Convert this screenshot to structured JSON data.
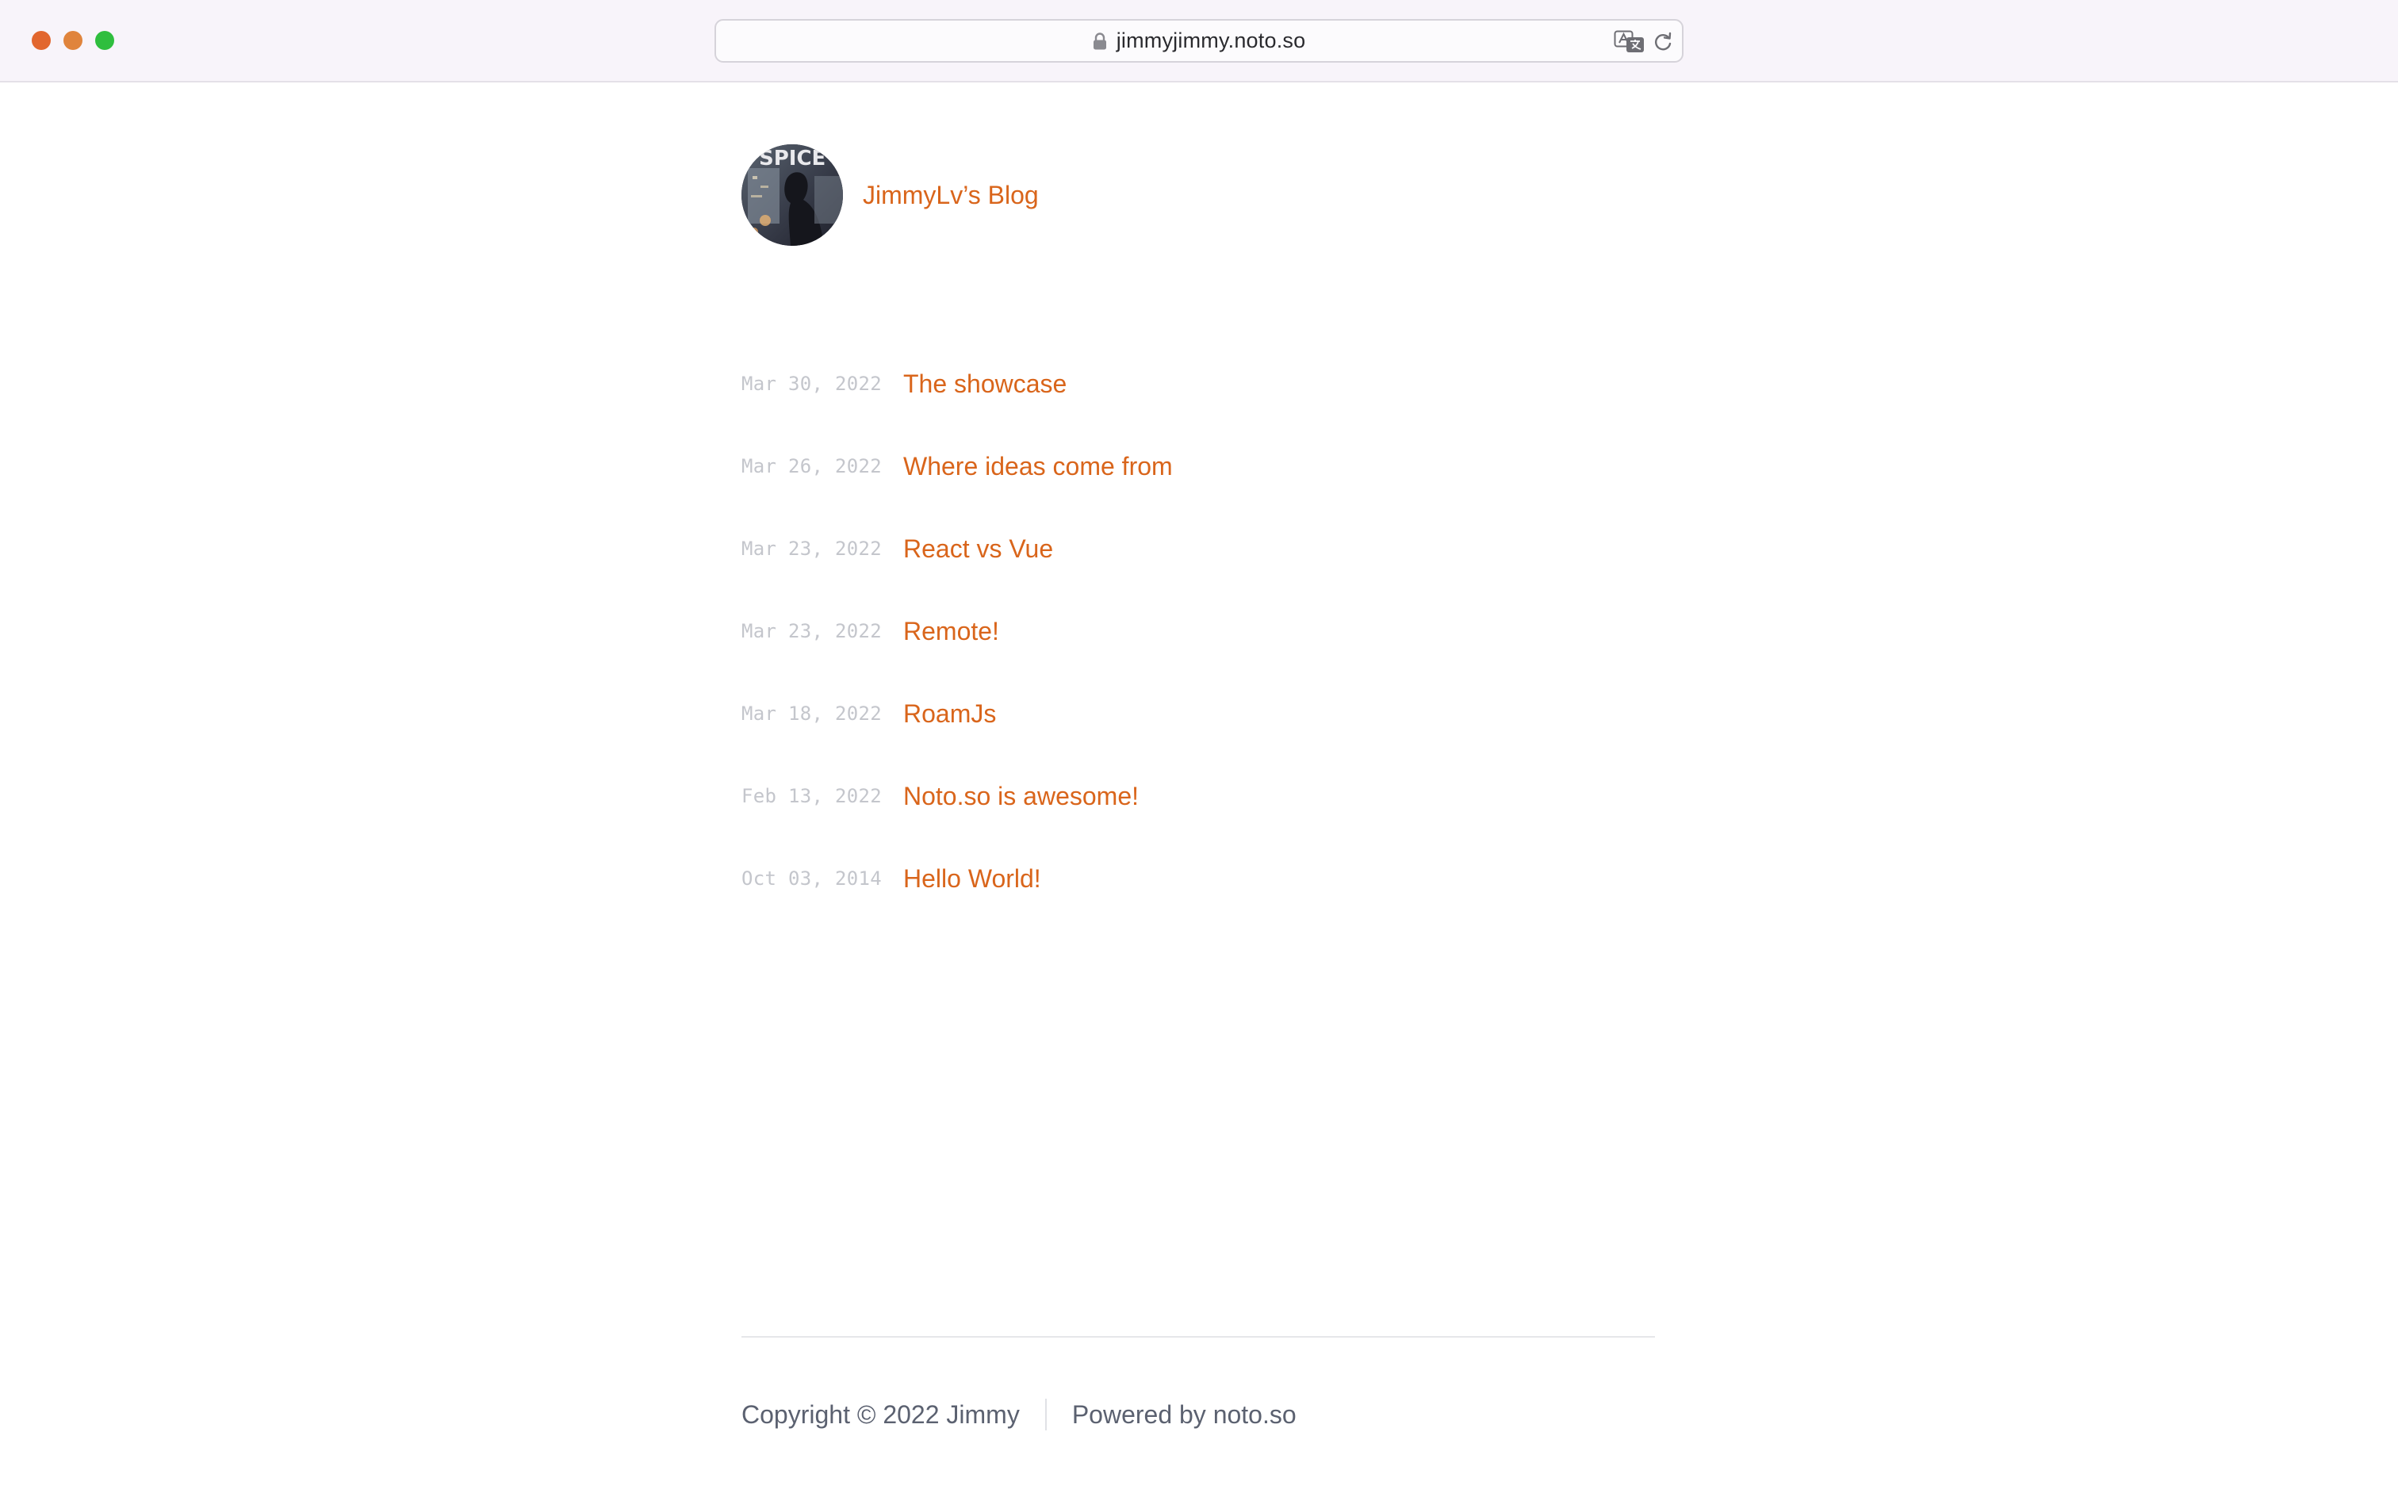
{
  "browser": {
    "url": "jimmyjimmy.noto.so",
    "traffic_lights": {
      "close": "#e2662e",
      "minimize": "#e0843c",
      "maximize": "#2fbe3e"
    },
    "icons": [
      "lock-icon",
      "translate-icon",
      "reload-icon"
    ]
  },
  "blog": {
    "title": "JimmyLv’s Blog",
    "avatar_icon": "avatar-photo",
    "accent_color": "#d9651b"
  },
  "posts": [
    {
      "date": "Mar 30, 2022",
      "title": "The showcase"
    },
    {
      "date": "Mar 26, 2022",
      "title": "Where ideas come from"
    },
    {
      "date": "Mar 23, 2022",
      "title": "React vs Vue"
    },
    {
      "date": "Mar 23, 2022",
      "title": "Remote!"
    },
    {
      "date": "Mar 18, 2022",
      "title": "RoamJs"
    },
    {
      "date": "Feb 13, 2022",
      "title": "Noto.so is awesome!"
    },
    {
      "date": "Oct 03, 2014",
      "title": "Hello World!"
    }
  ],
  "footer": {
    "copyright": "Copyright © 2022 Jimmy",
    "powered_by": "Powered by noto.so"
  }
}
